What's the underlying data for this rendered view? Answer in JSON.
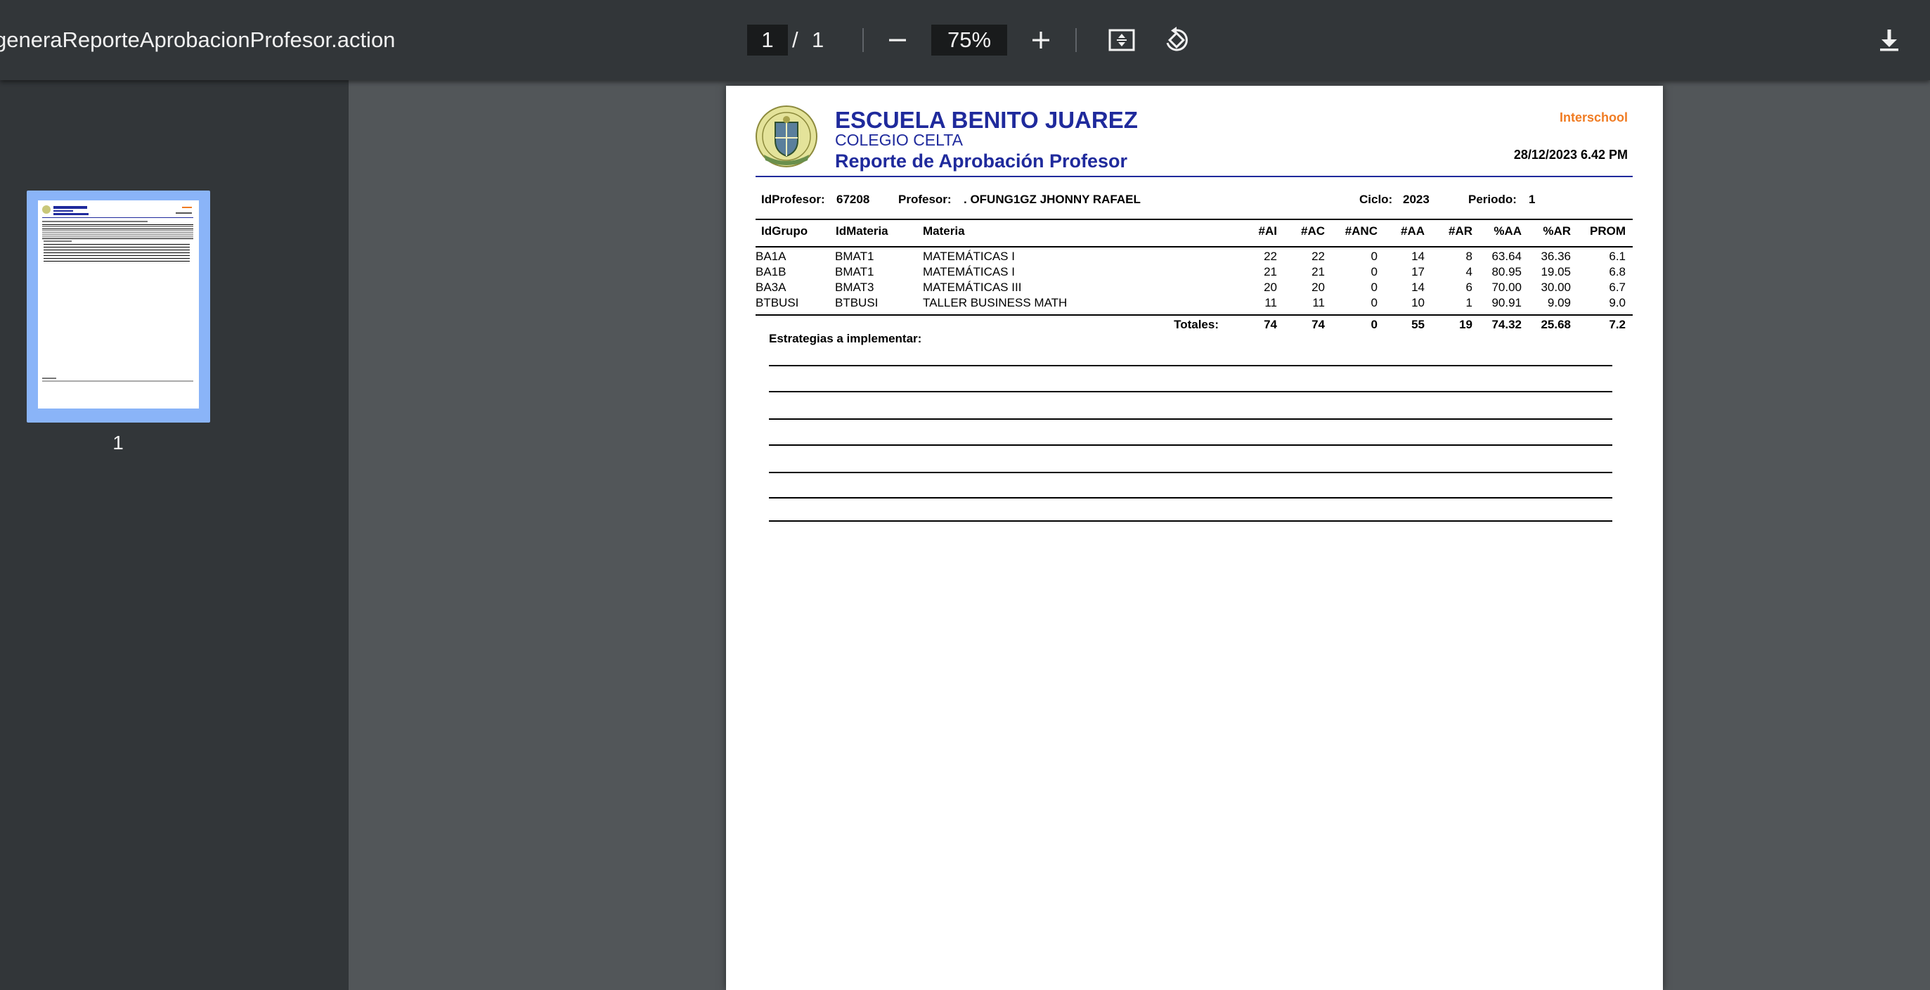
{
  "toolbar": {
    "title": "generaReporteAprobacionProfesor.action",
    "current_page": "1",
    "separator": "/",
    "total_pages": "1",
    "zoom": "75%",
    "icons": [
      "minus-icon",
      "plus-icon",
      "fit-page-icon",
      "rotate-icon",
      "download-icon"
    ]
  },
  "sidebar": {
    "thumbnail_label": "1"
  },
  "report": {
    "school": "ESCUELA BENITO JUAREZ",
    "campus": "COLEGIO CELTA",
    "title": "Reporte de Aprobación Profesor",
    "brand": "Interschool",
    "date": "28/12/2023 6.42 PM",
    "id_profesor_label": "IdProfesor:",
    "id_profesor": "67208",
    "profesor_label": "Profesor:",
    "profesor": ". OFUNG1GZ JHONNY RAFAEL",
    "ciclo_label": "Ciclo:",
    "ciclo": "2023",
    "periodo_label": "Periodo:",
    "periodo": "1",
    "columns": [
      "IdGrupo",
      "IdMateria",
      "Materia",
      "#AI",
      "#AC",
      "#ANC",
      "#AA",
      "#AR",
      "%AA",
      "%AR",
      "PROM"
    ],
    "rows": [
      [
        "BA1A",
        "BMAT1",
        "MATEMÁTICAS I",
        "22",
        "22",
        "0",
        "14",
        "8",
        "63.64",
        "36.36",
        "6.1"
      ],
      [
        "BA1B",
        "BMAT1",
        "MATEMÁTICAS I",
        "21",
        "21",
        "0",
        "17",
        "4",
        "80.95",
        "19.05",
        "6.8"
      ],
      [
        "BA3A",
        "BMAT3",
        "MATEMÁTICAS III",
        "20",
        "20",
        "0",
        "14",
        "6",
        "70.00",
        "30.00",
        "6.7"
      ],
      [
        "BTBUSI",
        "BTBUSI",
        "TALLER BUSINESS MATH",
        "11",
        "11",
        "0",
        "10",
        "1",
        "90.91",
        "9.09",
        "9.0"
      ]
    ],
    "totals_label": "Totales:",
    "totals": [
      "74",
      "74",
      "0",
      "55",
      "19",
      "74.32",
      "25.68",
      "7.2"
    ],
    "strategies_label": "Estrategias a implementar:"
  },
  "colors": {
    "toolbar_bg": "#323639",
    "viewer_bg": "#525659",
    "school_blue": "#1f2a9c",
    "brand_orange": "#f07c23",
    "thumbnail_highlight": "#8ab4f8"
  }
}
